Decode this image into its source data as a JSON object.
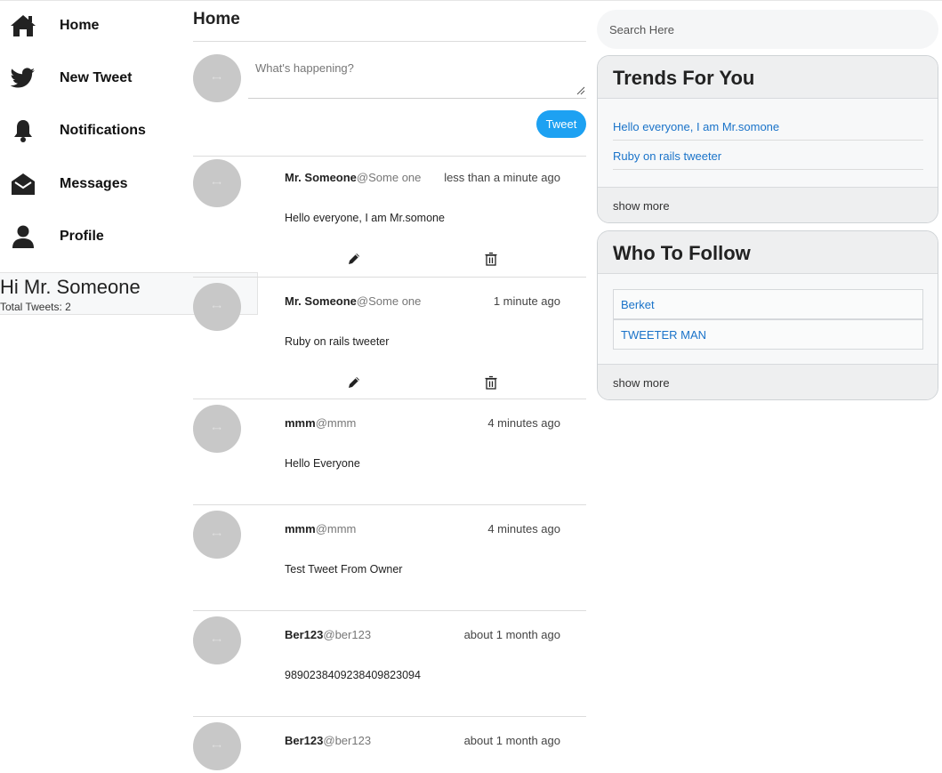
{
  "nav": {
    "items": [
      {
        "label": "Home",
        "icon": "home-icon"
      },
      {
        "label": "New Tweet",
        "icon": "bird-icon"
      },
      {
        "label": "Notifications",
        "icon": "bell-icon"
      },
      {
        "label": "Messages",
        "icon": "envelope-open-icon"
      },
      {
        "label": "Profile",
        "icon": "user-icon"
      }
    ]
  },
  "profile_card": {
    "greeting": "Hi Mr. Someone",
    "total_tweets": "Total Tweets: 2"
  },
  "feed": {
    "title": "Home",
    "compose": {
      "placeholder": "What's happening?",
      "button_label": "Tweet"
    },
    "tweets": [
      {
        "name": "Mr. Someone",
        "handle": "@Some one",
        "time": "less than a minute ago",
        "body": "Hello everyone, I am Mr.somone",
        "editable": true
      },
      {
        "name": "Mr. Someone",
        "handle": "@Some one",
        "time": "1 minute ago",
        "body": "Ruby on rails tweeter",
        "editable": true
      },
      {
        "name": "mmm",
        "handle": "@mmm",
        "time": "4 minutes ago",
        "body": "Hello Everyone",
        "editable": false
      },
      {
        "name": "mmm",
        "handle": "@mmm",
        "time": "4 minutes ago",
        "body": "Test Tweet From Owner",
        "editable": false
      },
      {
        "name": "Ber123",
        "handle": "@ber123",
        "time": "about 1 month ago",
        "body": "9890238409238409823094",
        "editable": false
      },
      {
        "name": "Ber123",
        "handle": "@ber123",
        "time": "about 1 month ago",
        "body": "",
        "editable": false
      }
    ]
  },
  "search": {
    "placeholder": "Search Here"
  },
  "trends": {
    "title": "Trends For You",
    "items": [
      "Hello everyone, I am Mr.somone",
      "Ruby on rails tweeter"
    ],
    "show_more": "show more"
  },
  "who_to_follow": {
    "title": "Who To Follow",
    "items": [
      "Berket",
      "TWEETER MAN"
    ],
    "show_more": "show more"
  },
  "colors": {
    "accent": "#1da1f2",
    "link": "#1a73c9",
    "avatar": "#c8c8c8"
  }
}
